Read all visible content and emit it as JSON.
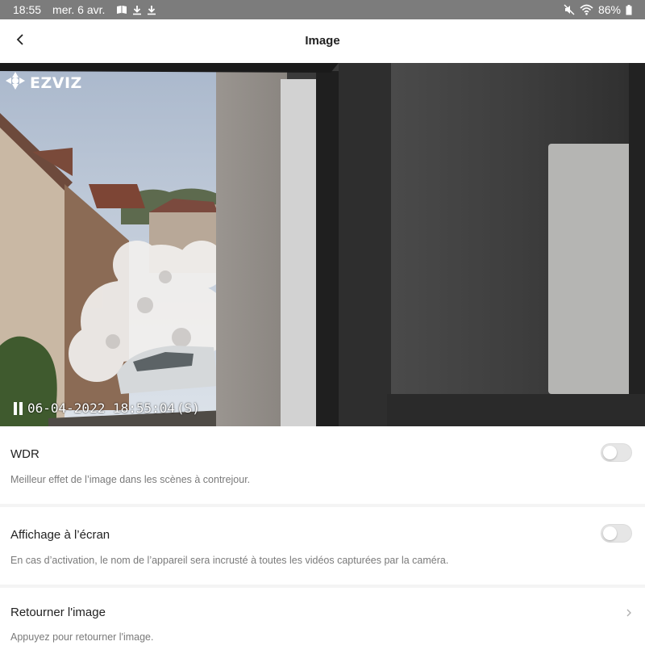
{
  "status_bar": {
    "time": "18:55",
    "date": "mer. 6 avr.",
    "battery": "86%",
    "left_icons": [
      "book-icon",
      "download-icon",
      "download-icon"
    ],
    "right_icons": [
      "mute-icon",
      "wifi-icon",
      "battery-icon"
    ]
  },
  "header": {
    "title": "Image",
    "back_icon": "chevron-left-icon"
  },
  "camera": {
    "brand": "EZVIZ",
    "osd_timestamp": "06-04-2022 18:55:04",
    "osd_day": "(S)"
  },
  "settings": {
    "wdr": {
      "title": "WDR",
      "description": "Meilleur effet de l’image dans les scènes à contrejour.",
      "enabled": false
    },
    "osd": {
      "title": "Affichage à l’écran",
      "description": "En cas d’activation, le nom de l’appareil sera incrusté à toutes les vidéos capturées par la caméra.",
      "enabled": false
    },
    "flip": {
      "title": "Retourner l'image",
      "description": "Appuyez pour retourner l'image."
    }
  },
  "colors": {
    "status_bar": "#7c7c7c",
    "toggle_off": "#e6e6e6",
    "section_gap": "#f4f4f4"
  }
}
